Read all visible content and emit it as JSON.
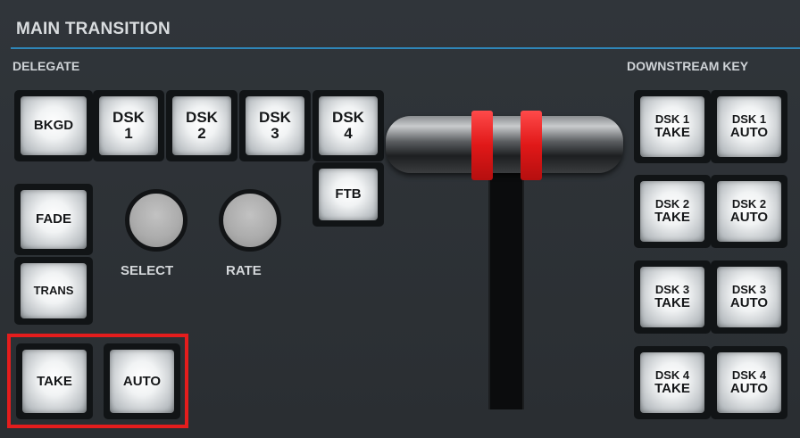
{
  "panel": {
    "title": "MAIN TRANSITION",
    "delegate_label": "DELEGATE",
    "downstream_key_label": "DOWNSTREAM KEY",
    "accent_color": "#2f86b8",
    "highlight_color": "#e41d1d",
    "tbar_color": "#e01818"
  },
  "delegate": {
    "bkgd": "BKGD",
    "dsk1": [
      "DSK",
      "1"
    ],
    "dsk2": [
      "DSK",
      "2"
    ],
    "dsk3": [
      "DSK",
      "3"
    ],
    "dsk4": [
      "DSK",
      "4"
    ],
    "ftb": "FTB"
  },
  "transition": {
    "fade": "FADE",
    "trans": "TRANS",
    "select_label": "SELECT",
    "rate_label": "RATE",
    "take": "TAKE",
    "auto": "AUTO"
  },
  "downstream": [
    {
      "take": [
        "DSK 1",
        "TAKE"
      ],
      "auto": [
        "DSK 1",
        "AUTO"
      ]
    },
    {
      "take": [
        "DSK 2",
        "TAKE"
      ],
      "auto": [
        "DSK 2",
        "AUTO"
      ]
    },
    {
      "take": [
        "DSK 3",
        "TAKE"
      ],
      "auto": [
        "DSK 3",
        "AUTO"
      ]
    },
    {
      "take": [
        "DSK 4",
        "TAKE"
      ],
      "auto": [
        "DSK 4",
        "AUTO"
      ]
    }
  ]
}
